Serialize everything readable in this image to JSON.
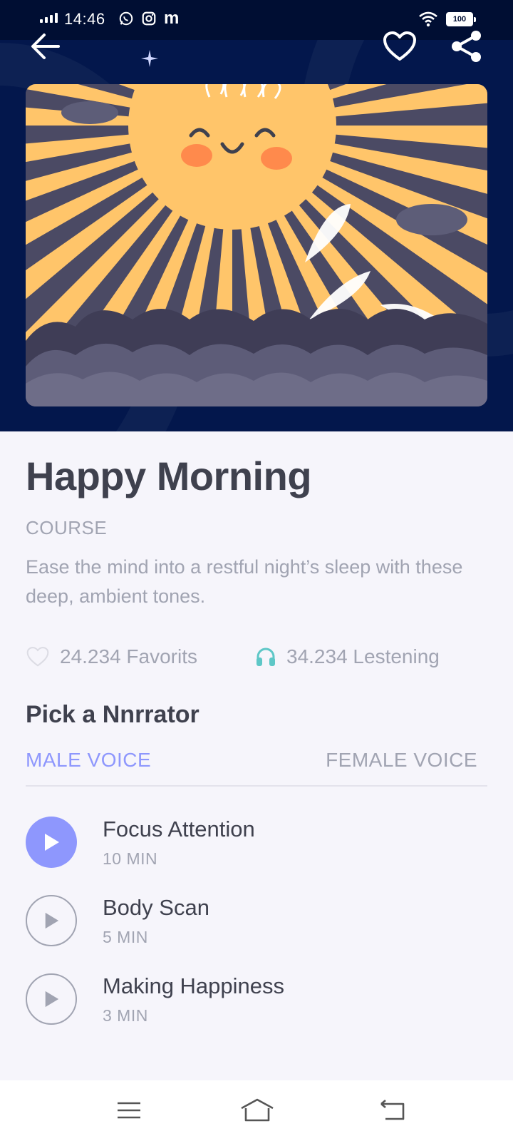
{
  "status_bar": {
    "time": "14:46",
    "carrier_icon_letter": "m",
    "battery": "100",
    "icons": [
      "signal-icon",
      "whatsapp-icon",
      "instagram-icon",
      "wifi-icon",
      "battery-icon"
    ]
  },
  "header": {
    "back_icon": "arrow-left-icon",
    "favorite_icon": "heart-outline-icon",
    "share_icon": "share-icon"
  },
  "course": {
    "title": "Happy Morning",
    "type": "COURSE",
    "description": "Ease the mind into a restful night’s sleep with these deep, ambient tones.",
    "favorites": "24.234 Favorits",
    "listening": "34.234 Lestening"
  },
  "narrator": {
    "heading": "Pick a Nnrrator",
    "tabs": [
      {
        "label": "MALE VOICE",
        "active": true
      },
      {
        "label": "FEMALE VOICE",
        "active": false
      }
    ]
  },
  "tracks": [
    {
      "name": "Focus Attention",
      "duration": "10 MIN",
      "active": true
    },
    {
      "name": "Body Scan",
      "duration": "5 MIN",
      "active": false
    },
    {
      "name": "Making Happiness",
      "duration": "3 MIN",
      "active": false
    }
  ],
  "colors": {
    "hero_bg": "#03174c",
    "accent": "#8e97fd",
    "title_text": "#3f414e",
    "muted_text": "#a1a4b2",
    "headphone_icon": "#5ec7c7",
    "sun": "#ffc56a"
  },
  "nav": [
    "menu-icon",
    "home-icon",
    "back-nav-icon"
  ]
}
